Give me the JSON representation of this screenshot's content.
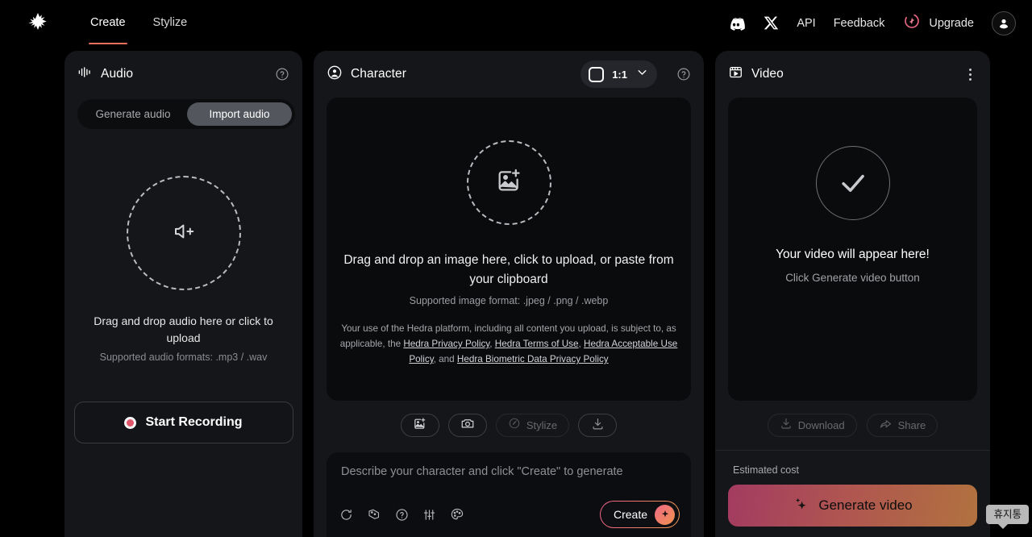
{
  "header": {
    "logo_icon": "hedra-logo-icon",
    "tabs": [
      {
        "label": "Create",
        "active": true
      },
      {
        "label": "Stylize",
        "active": false
      }
    ],
    "discord_icon": "discord-icon",
    "x_icon": "x-twitter-icon",
    "api_label": "API",
    "feedback_label": "Feedback",
    "upgrade_label": "Upgrade",
    "upgrade_icon": "sparkle-orbit-icon",
    "avatar_icon": "user-avatar-icon"
  },
  "audio_panel": {
    "title": "Audio",
    "title_icon": "audio-waveform-icon",
    "help_icon": "help-circle-icon",
    "tabs": [
      {
        "label": "Generate audio",
        "active": false
      },
      {
        "label": "Import audio",
        "active": true
      }
    ],
    "dropzone_icon": "speaker-plus-icon",
    "dropzone_title": "Drag and drop audio here or click to upload",
    "dropzone_sub": "Supported audio formats: .mp3 / .wav",
    "record_label": "Start Recording",
    "record_icon": "record-dot-icon"
  },
  "character_panel": {
    "title": "Character",
    "title_icon": "user-circle-icon",
    "help_icon": "help-circle-icon",
    "aspect_ratio": "1:1",
    "aspect_icon": "square-icon",
    "aspect_chevron": "chevron-down-icon",
    "dropzone_icon": "image-plus-icon",
    "dropzone_title": "Drag and drop an image here, click to upload, or paste from your clipboard",
    "dropzone_sub": "Supported image format: .jpeg / .png / .webp",
    "legal": {
      "prefix": "Your use of the Hedra platform, including all content you upload, is subject to, as applicable, the ",
      "links": [
        "Hedra Privacy Policy",
        "Hedra Terms of Use",
        "Hedra Acceptable Use Policy",
        "Hedra Biometric Data Privacy Policy"
      ],
      "sep1": ", ",
      "sep2": ", ",
      "sep3": ", and "
    },
    "tools": [
      {
        "name": "upload-image-button",
        "icon": "image-plus-icon",
        "label": ""
      },
      {
        "name": "camera-button",
        "icon": "camera-icon",
        "label": ""
      },
      {
        "name": "stylize-button",
        "icon": "stylize-icon",
        "label": "Stylize",
        "disabled": true
      },
      {
        "name": "download-button",
        "icon": "download-icon",
        "label": ""
      }
    ],
    "stylize_label": "Stylize",
    "prompt_placeholder": "Describe your character and click \"Create\" to generate",
    "prompt_value": "",
    "prompt_icons": [
      "refresh-icon",
      "dice-icon",
      "help-circle-icon",
      "sliders-icon",
      "palette-icon"
    ],
    "create_label": "Create",
    "create_icon": "sparkle-icon"
  },
  "video_panel": {
    "title": "Video",
    "title_icon": "video-clapperboard-icon",
    "menu_icon": "more-vertical-icon",
    "status_icon": "check-circle-icon",
    "empty_title": "Your video will appear here!",
    "empty_sub": "Click Generate video button",
    "download_label": "Download",
    "download_icon": "download-icon",
    "share_label": "Share",
    "share_icon": "share-arrow-icon",
    "cost_label": "Estimated cost",
    "generate_label": "Generate video",
    "generate_icon": "sparkles-icon"
  },
  "tooltip": {
    "text": "휴지통"
  },
  "colors": {
    "background": "#000000",
    "panel": "#151619",
    "inset": "#0a0b0d",
    "accent_underline": "#e8705c",
    "accent_pink": "#ef5f8a",
    "accent_orange": "#f0994f",
    "record_red": "#e0556a",
    "segment_active": "#53565d"
  }
}
